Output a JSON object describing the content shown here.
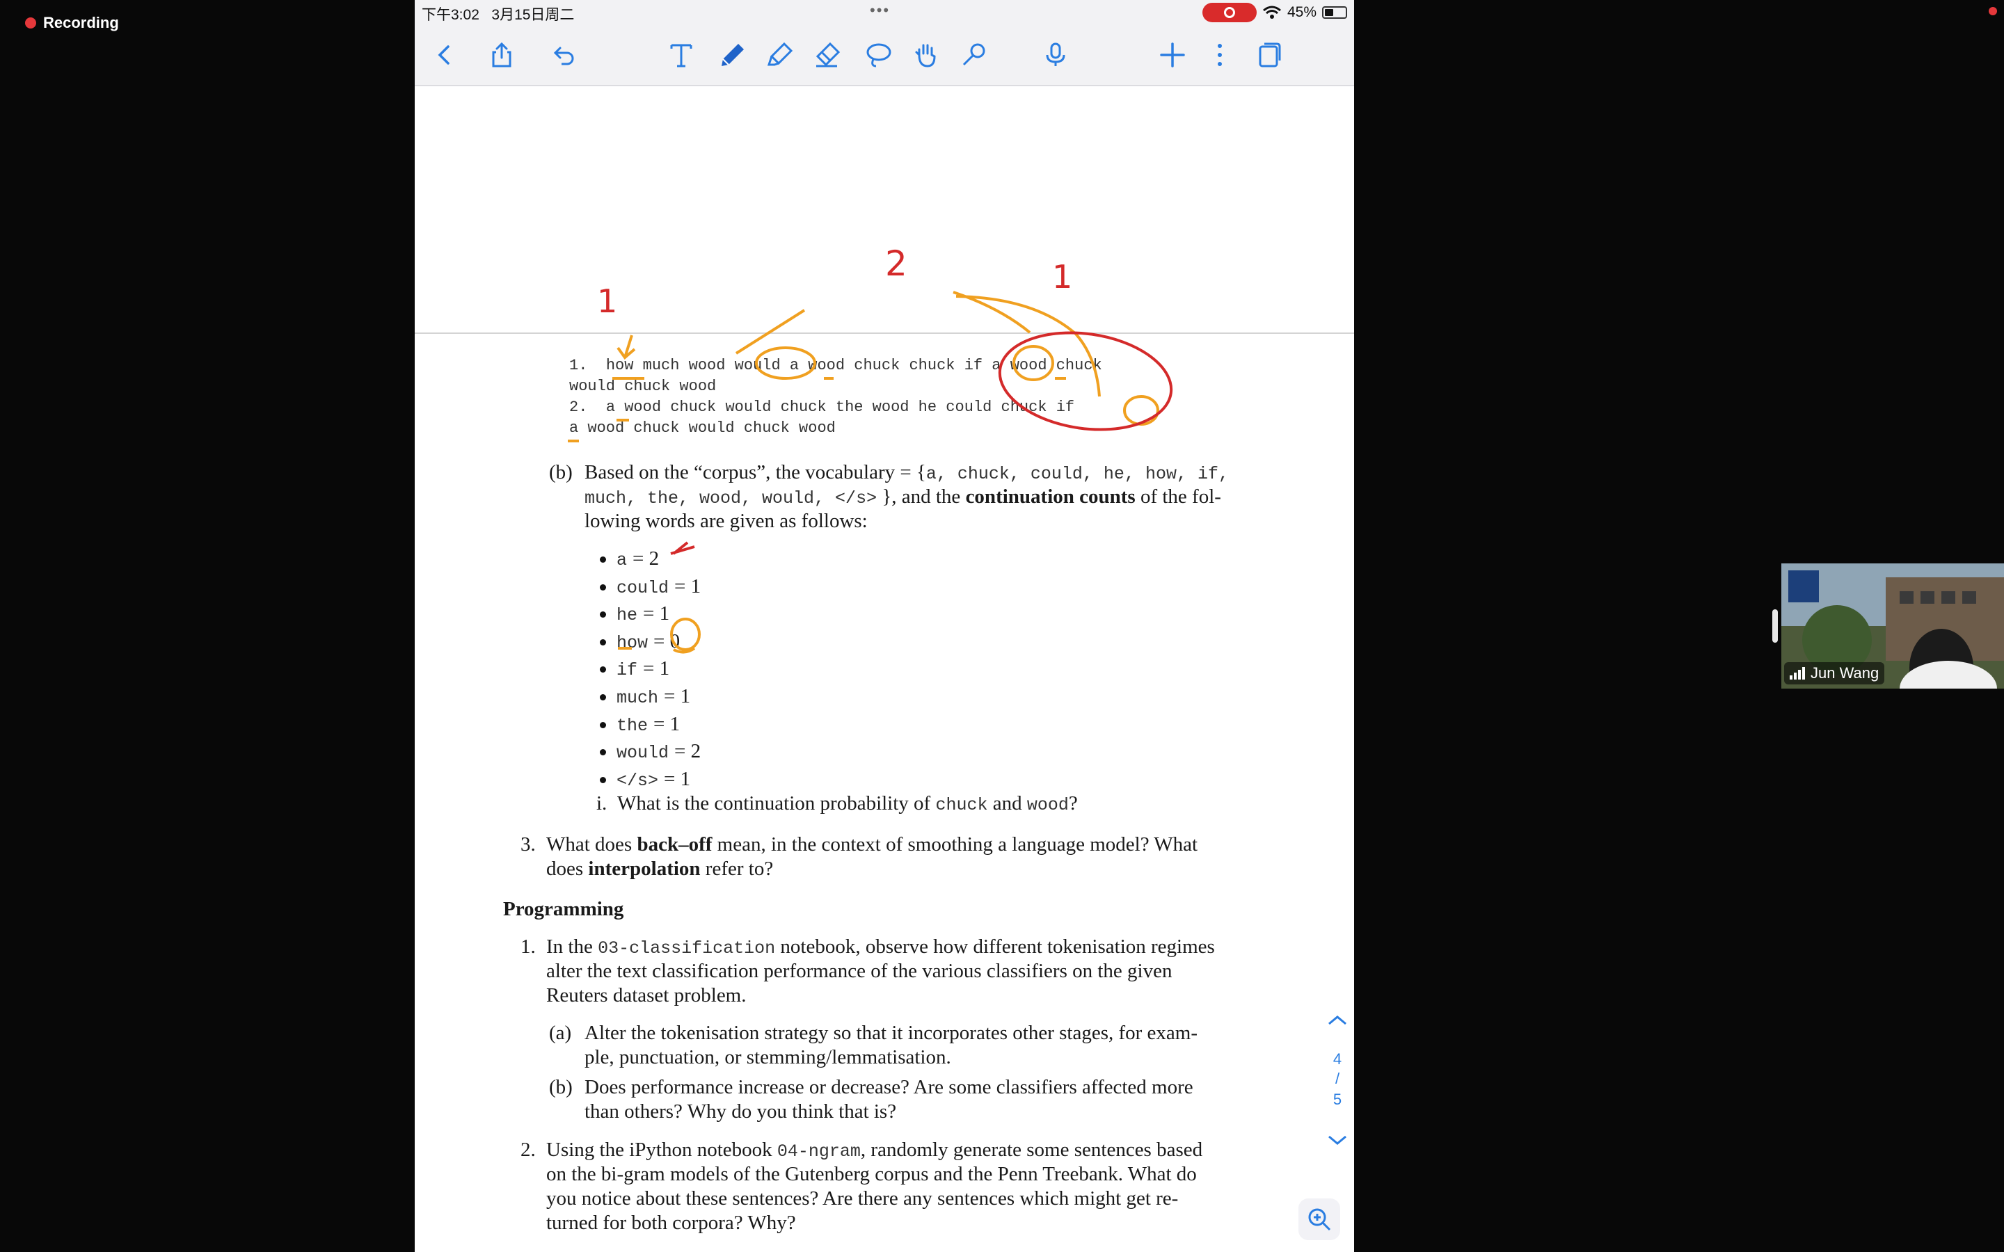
{
  "recording": {
    "label": "Recording"
  },
  "status_bar": {
    "time": "下午3:02",
    "date": "3月15日周二",
    "battery": "45%",
    "dots": "•••"
  },
  "toolbar": {
    "icons": [
      "back-chevron-icon",
      "share-icon",
      "undo-icon",
      "text-tool-icon",
      "pen-tool-icon",
      "highlighter-tool-icon",
      "eraser-tool-icon",
      "lasso-tool-icon",
      "hand-tool-icon",
      "shapes-tool-icon",
      "microphone-icon",
      "add-icon",
      "more-icon",
      "pages-icon"
    ],
    "accent_color": "#2a7de1"
  },
  "annotations": {
    "num_left": "1",
    "num_mid": "2",
    "num_right": "1",
    "orange": "#f0a020",
    "red": "#d42a2a"
  },
  "corpus": {
    "line1_num": "1.",
    "line1_a": "how much wood would a wood chuck chuck if a wood chuck",
    "line1_b": "would chuck wood",
    "line2_num": "2.",
    "line2_a": "a wood chuck would chuck the wood he could chuck if",
    "line2_b": "a wood chuck would chuck wood"
  },
  "part_b": {
    "label": "(b)",
    "l1_pre": "Based on the “corpus”, the vocabulary = {",
    "l1_vocab": "a, chuck, could, he, how, if,",
    "l2_vocab": "much, the, wood, would, </s>",
    "l2_post": " }, and the ",
    "l2_bold": "continuation counts",
    "l2_end": " of the fol-",
    "l3": "lowing words are given as follows:",
    "counts": [
      {
        "word": "a",
        "value": "= 2"
      },
      {
        "word": "could",
        "value": "= 1"
      },
      {
        "word": "he",
        "value": "= 1"
      },
      {
        "word": "how",
        "value": "= 0"
      },
      {
        "word": "if",
        "value": "= 1"
      },
      {
        "word": "much",
        "value": "= 1"
      },
      {
        "word": "the",
        "value": "= 1"
      },
      {
        "word": "would",
        "value": "= 2"
      },
      {
        "word": "</s>",
        "value": "= 1"
      }
    ],
    "q_i_label": "i.",
    "q_i_pre": "What is the continuation probability of ",
    "q_i_w1": "chuck",
    "q_i_mid": " and ",
    "q_i_w2": "wood",
    "q_i_end": "?"
  },
  "q3": {
    "label": "3.",
    "l1_pre": "What does ",
    "l1_bold": "back–off",
    "l1_post": " mean, in the context of smoothing a language model? What",
    "l2_pre": "does ",
    "l2_bold": "interpolation",
    "l2_post": " refer to?"
  },
  "programming": {
    "heading": "Programming",
    "p1": {
      "label": "1.",
      "l1_pre": "In the ",
      "l1_code": "03-classification",
      "l1_post": " notebook, observe how different tokenisation regimes",
      "l2": "alter the text classification performance of the various classifiers on the given",
      "l3": "Reuters dataset problem.",
      "a_label": "(a)",
      "a_l1": "Alter the tokenisation strategy so that it incorporates other stages, for exam-",
      "a_l2": "ple, punctuation, or stemming/lemmatisation.",
      "b_label": "(b)",
      "b_l1": "Does performance increase or decrease?  Are some classifiers affected more",
      "b_l2": "than others? Why do you think that is?"
    },
    "p2": {
      "label": "2.",
      "l1_pre": "Using the iPython notebook ",
      "l1_code": "04-ngram",
      "l1_post": ", randomly generate some sentences based",
      "l2": "on the bi-gram models of the Gutenberg corpus and the Penn Treebank. What do",
      "l3": "you notice about these sentences?  Are there any sentences which might get re-",
      "l4": "turned for both corpora? Why?"
    }
  },
  "page_nav": {
    "current": "4",
    "sep": "/",
    "total": "5"
  },
  "video": {
    "name": "Jun Wang"
  }
}
